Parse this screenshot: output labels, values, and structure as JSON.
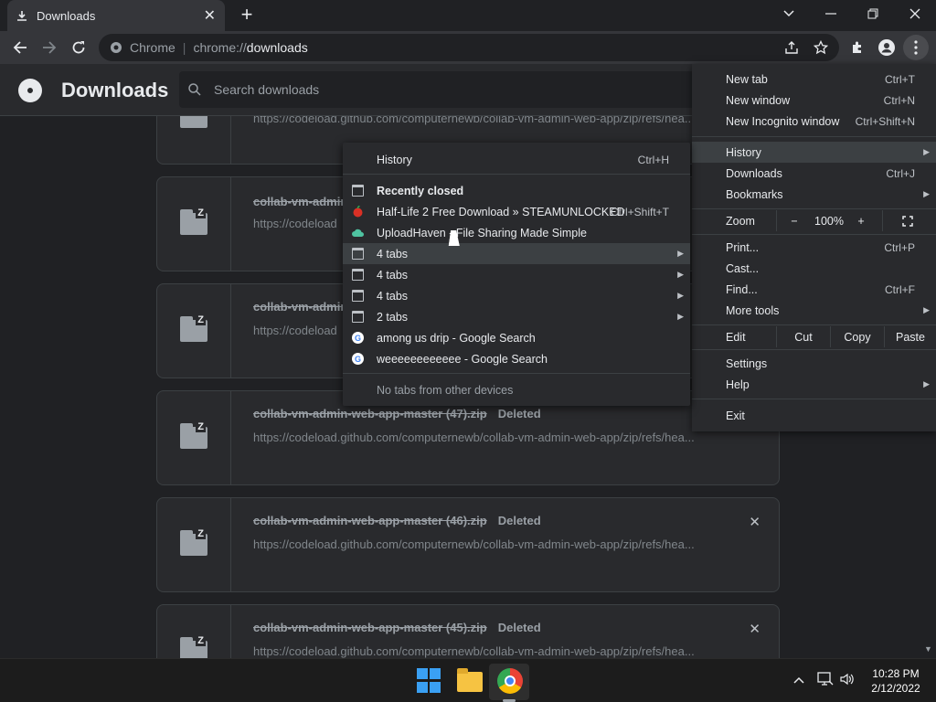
{
  "window": {
    "tab_title": "Downloads",
    "minimize": "—",
    "restore": "❐",
    "close": "✕",
    "tab_dropdown": "⌄"
  },
  "omnibox": {
    "site_label": "Chrome",
    "url_scheme": "chrome://",
    "url_host": "downloads"
  },
  "page": {
    "title": "Downloads",
    "search_placeholder": "Search downloads"
  },
  "downloads": [
    {
      "name": "",
      "status": "",
      "url": "https://codeload.github.com/computernewb/collab-vm-admin-web-app/zip/refs/hea..."
    },
    {
      "name": "collab-vm-admin",
      "status": "",
      "url": "https://codeload"
    },
    {
      "name": "collab-vm-admin",
      "status": "",
      "url": "https://codeload"
    },
    {
      "name": "collab-vm-admin-web-app-master (47).zip",
      "status": "Deleted",
      "url": "https://codeload.github.com/computernewb/collab-vm-admin-web-app/zip/refs/hea..."
    },
    {
      "name": "collab-vm-admin-web-app-master (46).zip",
      "status": "Deleted",
      "url": "https://codeload.github.com/computernewb/collab-vm-admin-web-app/zip/refs/hea..."
    },
    {
      "name": "collab-vm-admin-web-app-master (45).zip",
      "status": "Deleted",
      "url": "https://codeload.github.com/computernewb/collab-vm-admin-web-app/zip/refs/hea..."
    }
  ],
  "chrome_menu": {
    "new_tab": {
      "label": "New tab",
      "shortcut": "Ctrl+T"
    },
    "new_window": {
      "label": "New window",
      "shortcut": "Ctrl+N"
    },
    "new_incognito": {
      "label": "New Incognito window",
      "shortcut": "Ctrl+Shift+N"
    },
    "history": {
      "label": "History"
    },
    "downloads": {
      "label": "Downloads",
      "shortcut": "Ctrl+J"
    },
    "bookmarks": {
      "label": "Bookmarks"
    },
    "zoom": {
      "label": "Zoom",
      "minus": "−",
      "value": "100%",
      "plus": "+"
    },
    "print": {
      "label": "Print...",
      "shortcut": "Ctrl+P"
    },
    "cast": {
      "label": "Cast..."
    },
    "find": {
      "label": "Find...",
      "shortcut": "Ctrl+F"
    },
    "more_tools": {
      "label": "More tools"
    },
    "edit": {
      "label": "Edit",
      "cut": "Cut",
      "copy": "Copy",
      "paste": "Paste"
    },
    "settings": {
      "label": "Settings"
    },
    "help": {
      "label": "Help"
    },
    "exit": {
      "label": "Exit"
    }
  },
  "history_menu": {
    "history": {
      "label": "History",
      "shortcut": "Ctrl+H"
    },
    "recently_closed": "Recently closed",
    "items": [
      {
        "label": "Half-Life 2 Free Download » STEAMUNLOCKED",
        "shortcut": "Ctrl+Shift+T"
      },
      {
        "label": "UploadHaven - File Sharing Made Simple"
      },
      {
        "label": "4 tabs"
      },
      {
        "label": "4 tabs"
      },
      {
        "label": "4 tabs"
      },
      {
        "label": "2 tabs"
      },
      {
        "label": "among us drip - Google Search"
      },
      {
        "label": "weeeeeeeeeeee - Google Search"
      }
    ],
    "no_tabs": "No tabs from other devices"
  },
  "taskbar": {
    "time": "10:28 PM",
    "date": "2/12/2022"
  }
}
